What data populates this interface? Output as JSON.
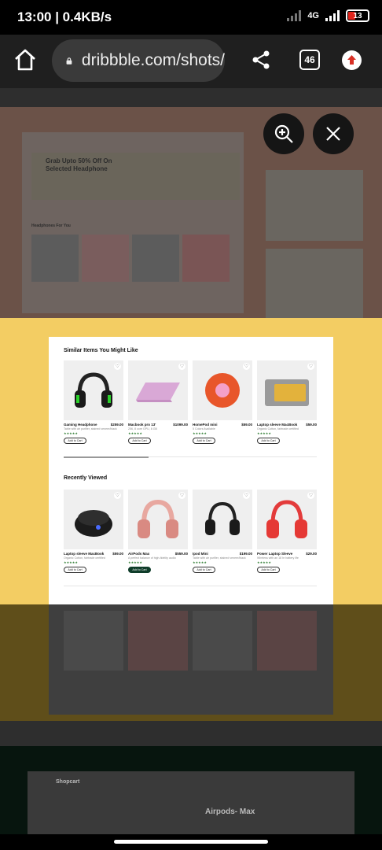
{
  "status": {
    "time": "13:00 | 0.4KB/s",
    "network": "4G",
    "battery": "13"
  },
  "browser": {
    "url": "dribbble.com/shots/",
    "tab_count": "46"
  },
  "similar": {
    "title": "Similar Items You Might Like",
    "items": [
      {
        "name": "Gaming Headphone",
        "price": "$259.00",
        "desc": "Table with air purifier, stained veneer/black",
        "button": "Add to Cart"
      },
      {
        "name": "Macbook pro 13'",
        "price": "$1099.00",
        "desc": "256, 8 core GPU, 8 GB",
        "button": "Add to Cart"
      },
      {
        "name": "HomePod mini",
        "price": "$59.00",
        "desc": "5 Colors Available",
        "button": "Add to Cart"
      },
      {
        "name": "Laptop sleeve MacBook",
        "price": "$59.00",
        "desc": "Organic Cotton, fairtrade certified",
        "button": "Add to Cart"
      }
    ]
  },
  "recent": {
    "title": "Recently Viewed",
    "items": [
      {
        "name": "Laptop sleeve MacBook",
        "price": "$59.00",
        "desc": "Organic Cotton, fairtrade certified",
        "button": "Add to Cart"
      },
      {
        "name": "AirPods Max",
        "price": "$559.00",
        "desc": "A perfect balance of high-fidelity audio",
        "button": "Add to Cart"
      },
      {
        "name": "Ipod Mini",
        "price": "$199.00",
        "desc": "Table with air purifier, stained veneer/black",
        "button": "Add to Cart"
      },
      {
        "name": "Power Laptop Sleeve",
        "price": "$29.00",
        "desc": "Wireless with an 18 hr battery life",
        "button": "Add to Cart"
      }
    ]
  },
  "background": {
    "promo": "Grab Upto 50% Off On Selected Headphone",
    "section": "Headphones For You",
    "brand": "Shopcart",
    "product_title": "Airpods- Max"
  },
  "colors": {
    "band": "#f3cd63",
    "accent_green": "#0f3d2a"
  }
}
